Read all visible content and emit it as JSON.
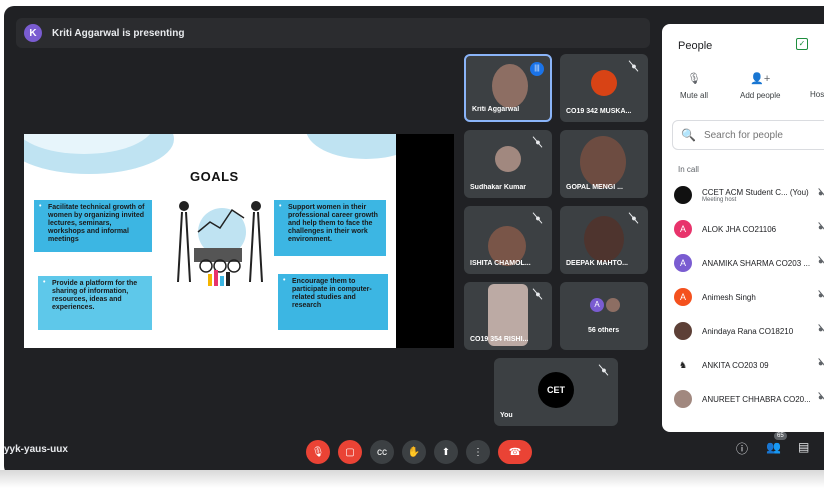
{
  "presenting": {
    "avatar_initial": "K",
    "text": "Kriti Aggarwal is presenting"
  },
  "slide": {
    "title": "GOALS",
    "boxes": [
      "Facilitate technical growth of women by organizing invited lectures, seminars, workshops and informal meetings",
      "Provide a platform for the sharing of information, resources, ideas and experiences.",
      "Support women in their professional career growth and help them to face the challenges in their work environment.",
      "Encourage them to participate in computer-related studies and research"
    ]
  },
  "tiles": [
    {
      "name": "Kriti Aggarwal"
    },
    {
      "name": "CO19 342 MUSKA..."
    },
    {
      "name": "Sudhakar Kumar"
    },
    {
      "name": "GOPAL MENGI ..."
    },
    {
      "name": "ISHITA CHAMOL..."
    },
    {
      "name": "DEEPAK MAHTO..."
    },
    {
      "name": "CO19 354 RISHI..."
    },
    {
      "name": "56 others",
      "avatar_initial": "A"
    },
    {
      "name": "You",
      "logo_text": "CET"
    }
  ],
  "bottom": {
    "meeting_code": "yyk-yaus-uux",
    "people_count": "65"
  },
  "panel": {
    "title": "People",
    "actions": {
      "mute_all": "Mute all",
      "add_people": "Add people",
      "host": "Hos"
    },
    "search_placeholder": "Search for people",
    "in_call_label": "In call",
    "people": [
      {
        "initial": "",
        "name": "CCET ACM Student C...  (You)",
        "sub": "Meeting host",
        "color": "#111111"
      },
      {
        "initial": "A",
        "name": "ALOK JHA CO21106",
        "sub": "",
        "color": "#e8336b"
      },
      {
        "initial": "A",
        "name": "ANAMIKA SHARMA CO203 ...",
        "sub": "",
        "color": "#7a5cd1"
      },
      {
        "initial": "A",
        "name": "Animesh Singh",
        "sub": "",
        "color": "#f4511e"
      },
      {
        "initial": "",
        "name": "Anindaya Rana CO18210",
        "sub": "",
        "color": "#5d4037"
      },
      {
        "initial": "",
        "name": "ANKITA CO203 09",
        "sub": "",
        "color": "#ffffff"
      },
      {
        "initial": "",
        "name": "ANUREET CHHABRA CO20...",
        "sub": "",
        "color": "#a1887f"
      }
    ]
  },
  "colors": {
    "background": "#202124",
    "tile": "#3c4043",
    "accent_blue": "#1a73e8",
    "danger": "#ea4335",
    "slide_box": "#3cb6e3"
  }
}
